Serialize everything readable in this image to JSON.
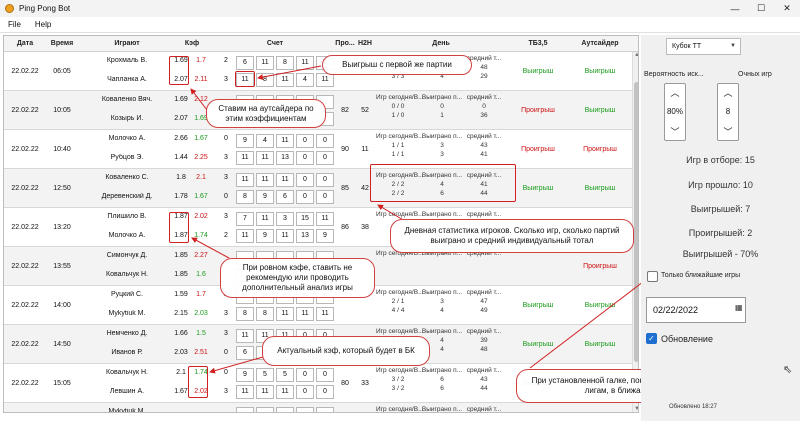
{
  "app": {
    "title": "Ping Pong Bot"
  },
  "window": {
    "min": "—",
    "max": "☐",
    "close": "✕"
  },
  "menu": [
    "File",
    "Help"
  ],
  "grid": {
    "headers": {
      "date": "Дата",
      "time": "Время",
      "players": "Играют",
      "odds": "Кэф",
      "score": "Счет",
      "pro": "Про...",
      "h2h": "H2H",
      "day": "День",
      "tb": "ТБ3,5",
      "outsider": "Аутсайдер"
    },
    "rows": [
      {
        "date": "22.02.22",
        "time": "06:05",
        "p1": "Крохмаль В.",
        "p2": "Чапланка А.",
        "o1": "1.69",
        "o2": "2.07",
        "n1": "1.7",
        "n2": "2.11",
        "sets1": "2",
        "sets2": "3",
        "s1": [
          "6",
          "11",
          "8",
          "11",
          "5"
        ],
        "s2": [
          "11",
          "8",
          "11",
          "4",
          "11"
        ],
        "pro": "",
        "h2h": "",
        "day": [
          "Игр сегодня/В... | Выиграно п... | средний т...",
          "2 / 2 | 3 | 48",
          "3 / 3 | 4 | 29"
        ],
        "tb": "Выигрыш",
        "out": "Выигрыш",
        "tbc": "g",
        "outc": "g"
      },
      {
        "date": "22.02.22",
        "time": "10:05",
        "p1": "Коваленко Вяч.",
        "p2": "Козырь И.",
        "o1": "1.69",
        "o2": "2.07",
        "n1": "2.12",
        "n2": "1.69",
        "sets1": "",
        "sets2": "",
        "s1": [
          "",
          "",
          "",
          "",
          ""
        ],
        "s2": [
          "",
          "",
          "",
          "",
          ""
        ],
        "pro": "82",
        "h2h": "52",
        "day": [
          "Игр сегодня/В... | Выиграно п... | средний т...",
          "0 / 0 | 0 | 0",
          "1 / 0 | 1 | 36"
        ],
        "tb": "Проигрыш",
        "out": "Выигрыш",
        "tbc": "r",
        "outc": "g"
      },
      {
        "date": "22.02.22",
        "time": "10:40",
        "p1": "Молочко А.",
        "p2": "Рубцов Э.",
        "o1": "2.66",
        "o2": "1.44",
        "n1": "1.67",
        "n2": "2.25",
        "sets1": "0",
        "sets2": "3",
        "s1": [
          "9",
          "4",
          "11",
          "0",
          "0"
        ],
        "s2": [
          "11",
          "11",
          "13",
          "0",
          "0"
        ],
        "pro": "90",
        "h2h": "11",
        "day": [
          "Игр сегодня/В... | Выиграно п... | средний т...",
          "1 / 1 | 3 | 43",
          "1 / 1 | 3 | 41"
        ],
        "tb": "Проигрыш",
        "out": "Проигрыш",
        "tbc": "r",
        "outc": "r"
      },
      {
        "date": "22.02.22",
        "time": "12:50",
        "p1": "Коваленко С.",
        "p2": "Деревенский Д.",
        "o1": "1.8",
        "o2": "1.78",
        "n1": "2.1",
        "n2": "1.67",
        "sets1": "3",
        "sets2": "0",
        "s1": [
          "11",
          "11",
          "11",
          "0",
          "0"
        ],
        "s2": [
          "8",
          "9",
          "6",
          "0",
          "0"
        ],
        "pro": "85",
        "h2h": "42",
        "day": [
          "Игр сегодня/В... | Выиграно п... | средний т...",
          "2 / 2 | 4 | 41",
          "2 / 2 | 6 | 44"
        ],
        "tb": "Выигрыш",
        "out": "Выигрыш",
        "tbc": "g",
        "outc": "g"
      },
      {
        "date": "22.02.22",
        "time": "13:20",
        "p1": "Плишило В.",
        "p2": "Молочко А.",
        "o1": "1.87",
        "o2": "1.87",
        "n1": "2.02",
        "n2": "1.74",
        "sets1": "3",
        "sets2": "2",
        "s1": [
          "7",
          "11",
          "3",
          "15",
          "11"
        ],
        "s2": [
          "11",
          "9",
          "11",
          "13",
          "9"
        ],
        "pro": "86",
        "h2h": "38",
        "day": [
          "Игр сегодня/В... | Выиграно п... | средний т...",
          "",
          ""
        ],
        "tb": "",
        "out": "",
        "tbc": "g",
        "outc": "g"
      },
      {
        "date": "22.02.22",
        "time": "13:55",
        "p1": "Симончук Д.",
        "p2": "Ковальчук Н.",
        "o1": "1.85",
        "o2": "1.85",
        "n1": "2.27",
        "n2": "1.6",
        "sets1": "",
        "sets2": "",
        "s1": [
          "",
          "",
          "",
          "",
          ""
        ],
        "s2": [
          "",
          "",
          "",
          "",
          ""
        ],
        "pro": "",
        "h2h": "",
        "day": [
          "Игр сегодня/В... | Выиграно п... | средний т...",
          "",
          ""
        ],
        "tb": "",
        "out": "Проигрыш",
        "tbc": "r",
        "outc": "r"
      },
      {
        "date": "22.02.22",
        "time": "14:00",
        "p1": "Руцкий С.",
        "p2": "Mykytiuk M.",
        "o1": "1.59",
        "o2": "2.15",
        "n1": "1.7",
        "n2": "2.03",
        "sets1": "2",
        "sets2": "3",
        "s1": [
          "11",
          "11",
          "6",
          "5",
          "9"
        ],
        "s2": [
          "8",
          "8",
          "11",
          "11",
          "11"
        ],
        "pro": "",
        "h2h": "",
        "day": [
          "Игр сегодня/В... | Выиграно п... | средний т...",
          "2 / 1 | 3 | 47",
          "4 / 4 | 4 | 49"
        ],
        "tb": "Выигрыш",
        "out": "Выигрыш",
        "tbc": "g",
        "outc": "g"
      },
      {
        "date": "22.02.22",
        "time": "14:50",
        "p1": "Немченко Д.",
        "p2": "Иванов Р.",
        "o1": "1.66",
        "o2": "2.03",
        "n1": "1.5",
        "n2": "2.51",
        "sets1": "3",
        "sets2": "0",
        "s1": [
          "11",
          "11",
          "11",
          "0",
          "0"
        ],
        "s2": [
          "6",
          "8",
          "8",
          "0",
          "0"
        ],
        "pro": "",
        "h2h": "",
        "day": [
          "Игр сегодня/В... | Выиграно п... | средний т...",
          "1 / 1 | 4 | 39",
          "2 / 1 | 4 | 48"
        ],
        "tb": "Выигрыш",
        "out": "Выигрыш",
        "tbc": "g",
        "outc": "g"
      },
      {
        "date": "22.02.22",
        "time": "15:05",
        "p1": "Ковальчук Н.",
        "p2": "Левшин А.",
        "o1": "2.1",
        "o2": "1.67",
        "n1": "1.74",
        "n2": "2.02",
        "sets1": "0",
        "sets2": "3",
        "s1": [
          "9",
          "5",
          "5",
          "0",
          "0"
        ],
        "s2": [
          "11",
          "11",
          "11",
          "0",
          "0"
        ],
        "pro": "80",
        "h2h": "33",
        "day": [
          "Игр сегодня/В... | Выиграно п... | средний т...",
          "3 / 2 | 6 | 43",
          "3 / 2 | 6 | 44"
        ],
        "tb": "Выигрыш",
        "out": "Выигрыш",
        "tbc": "g",
        "outc": "g"
      },
      {
        "date": "22.02.22",
        "time": "",
        "p1": "Mykytiuk M.",
        "p2": "",
        "o1": "",
        "o2": "",
        "n1": "",
        "n2": "",
        "sets1": "",
        "sets2": "",
        "s1": [
          "",
          "",
          "",
          "",
          ""
        ],
        "s2": [
          "",
          "",
          "",
          "",
          ""
        ],
        "pro": "",
        "h2h": "",
        "day": [
          "Игр сегодня/В... | Выиграно п... | средний т...",
          "",
          ""
        ],
        "tb": "",
        "out": "",
        "tbc": "g",
        "outc": "g"
      }
    ]
  },
  "callouts": {
    "first_set": "Выигрыш с первой же партии",
    "outsider": "Ставим на аутсайдера по этим коэффициентам",
    "equal_odds": "При ровном кэфе, ставить не рекомендую или проводить дополнительный анализ игры",
    "actual_odds": "Актуальный кэф, который будет в БК",
    "day_stats": "Дневная статистика игроков. Сколько игр, сколько партий выиграно и средний индивидуальный тотал",
    "checkbox_hint": "При установленной галке, показывает отбор по всем лигам, в ближайший час"
  },
  "side": {
    "league": "Кубок ТТ",
    "prob_label": "Вероятность иск...",
    "prob_value": "80%",
    "points_label": "Очных игр",
    "points_value": "8",
    "stats": [
      "Игр в отборе: 15",
      "Игр прошло: 10",
      "Выигрышей: 7",
      "Проигрышей: 2",
      "Выигрышей - 70%"
    ],
    "nearest_label": "Только ближайшие игры",
    "date": "02/22/2022",
    "refresh_label": "Обновление",
    "updated": "Обновлено 18:27"
  }
}
